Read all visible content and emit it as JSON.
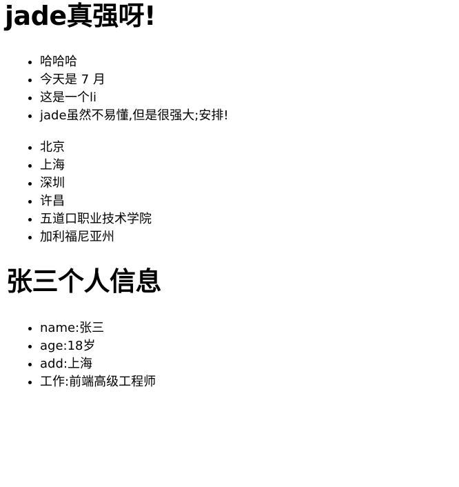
{
  "header": {
    "title": "jade真强呀!"
  },
  "intro_list": {
    "items": [
      "哈哈哈",
      "今天是 7 月",
      "这是一个li",
      "jade虽然不易懂,但是很强大;安排!"
    ]
  },
  "cities_list": {
    "items": [
      "北京",
      "上海",
      "深圳",
      "许昌",
      "五道口职业技术学院",
      "加利福尼亚州"
    ]
  },
  "profile": {
    "title": "张三个人信息",
    "items": [
      "name:张三",
      "age:18岁",
      "add:上海",
      "工作:前端高级工程师"
    ]
  }
}
